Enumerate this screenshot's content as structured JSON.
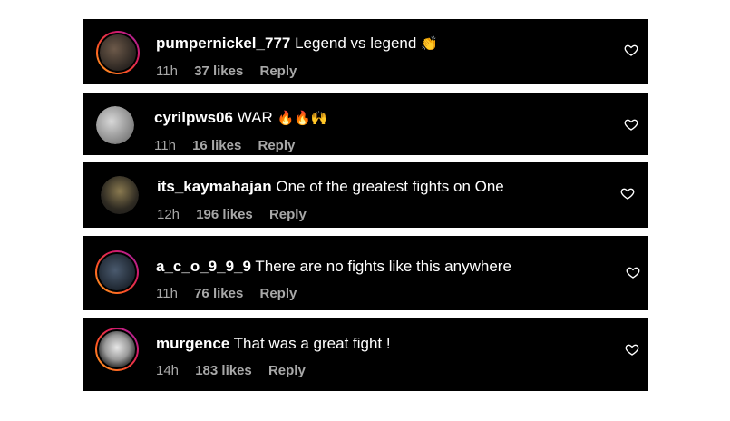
{
  "comments": [
    {
      "username": "pumpernickel_777",
      "text": "Legend vs legend",
      "emoji": "👏",
      "time": "11h",
      "likes": "37 likes",
      "reply": "Reply"
    },
    {
      "username": "cyrilpws06",
      "text": "WAR",
      "emoji": "🔥🔥🙌",
      "time": "11h",
      "likes": "16 likes",
      "reply": "Reply"
    },
    {
      "username": "its_kaymahajan",
      "text": "One of the greatest fights on One",
      "emoji": "",
      "time": "12h",
      "likes": "196 likes",
      "reply": "Reply"
    },
    {
      "username": "a_c_o_9_9_9",
      "text": "There are no fights like this anywhere",
      "emoji": "",
      "time": "11h",
      "likes": "76 likes",
      "reply": "Reply"
    },
    {
      "username": "murgence",
      "text": "That was a great fight !",
      "emoji": "",
      "time": "14h",
      "likes": "183 likes",
      "reply": "Reply"
    }
  ]
}
